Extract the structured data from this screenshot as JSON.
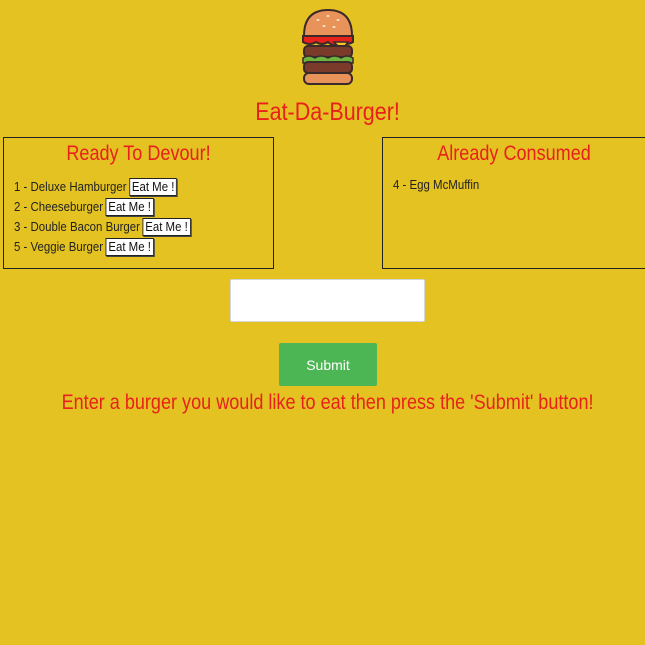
{
  "header": {
    "title": "Eat-Da-Burger!",
    "logo_icon": "hamburger-icon"
  },
  "devour": {
    "heading": "Ready To Devour!",
    "button_label": "Eat Me !",
    "items": [
      {
        "text": "1 - Deluxe Hamburger"
      },
      {
        "text": "2 - Cheeseburger"
      },
      {
        "text": "3 - Double Bacon Burger"
      },
      {
        "text": "5 - Veggie Burger"
      }
    ]
  },
  "consumed": {
    "heading": "Already Consumed",
    "items": [
      {
        "text": "4 - Egg McMuffin"
      }
    ]
  },
  "form": {
    "input_value": "",
    "input_placeholder": "",
    "submit_label": "Submit",
    "instructions": "Enter a burger you would like to eat then press the 'Submit' button!"
  },
  "colors": {
    "background": "#e4c222",
    "accent": "#e8211c",
    "submit": "#4db654"
  }
}
